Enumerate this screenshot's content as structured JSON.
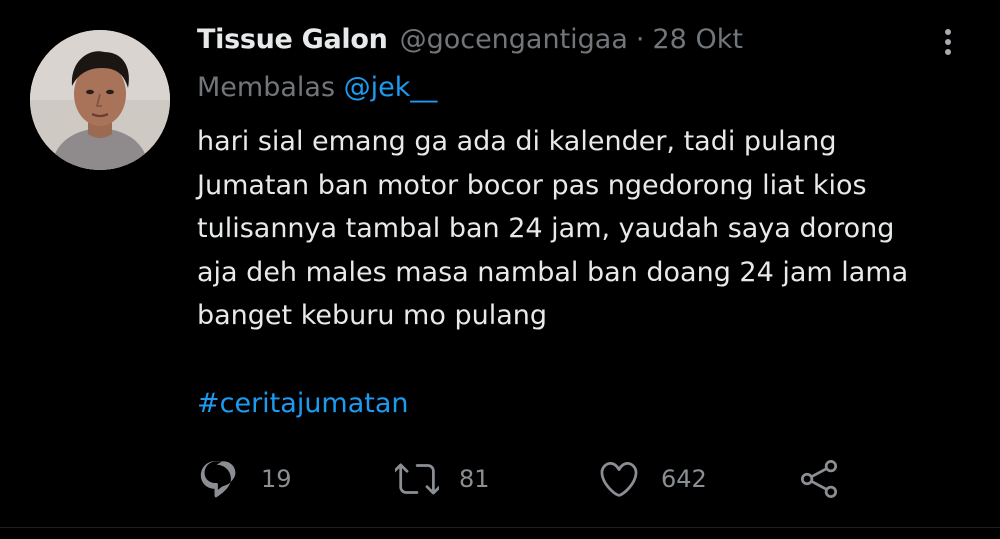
{
  "tweet": {
    "author_name": "Tissue Galon",
    "handle": "@gocengantigaa",
    "separator": "·",
    "date": "28 Okt",
    "reply_prefix": "Membalas",
    "reply_to": "@jek__",
    "lines": [
      "hari sial emang ga ada di kalender, tadi pulang",
      "Jumatan ban motor bocor pas ngedorong liat kios",
      "tulisannya tambal ban 24 jam, yaudah saya dorong",
      "aja deh males masa nambal ban doang 24 jam lama",
      "banget keburu mo pulang"
    ],
    "hashtag": "#ceritajumatan"
  },
  "actions": {
    "reply": {
      "icon": "comment-icon",
      "count": "19"
    },
    "retweet": {
      "icon": "retweet-icon",
      "count": "81"
    },
    "like": {
      "icon": "heart-icon",
      "count": "642"
    },
    "share": {
      "icon": "share-icon"
    }
  },
  "menu": {
    "icon": "more-vertical-icon"
  },
  "colors": {
    "background": "#000000",
    "text": "#e7e9ea",
    "muted": "#71767b",
    "accent": "#1d9bf0"
  }
}
